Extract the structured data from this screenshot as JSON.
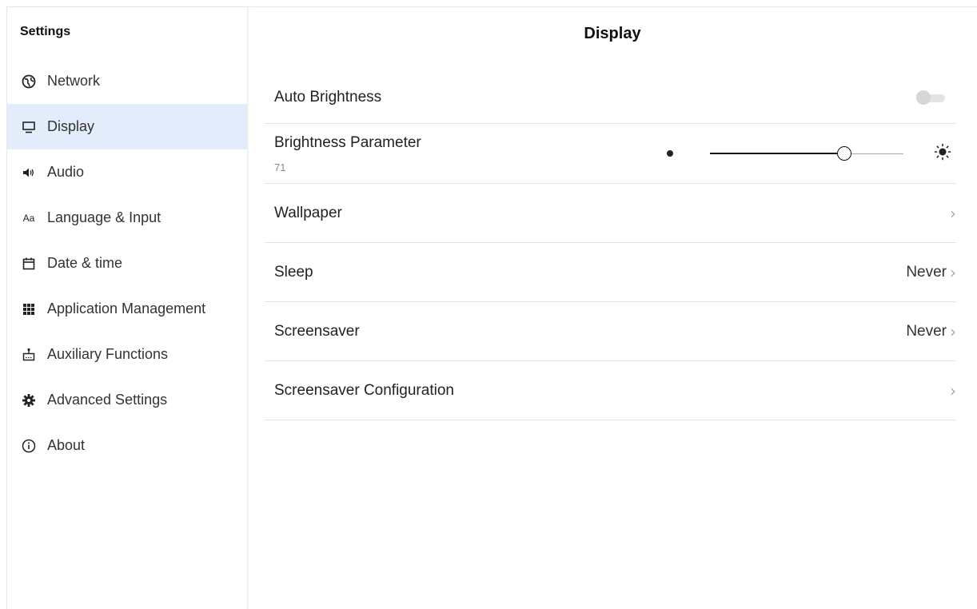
{
  "sidebar": {
    "title": "Settings",
    "items": [
      {
        "label": "Network",
        "icon": "globe-icon"
      },
      {
        "label": "Display",
        "icon": "monitor-icon"
      },
      {
        "label": "Audio",
        "icon": "speaker-icon"
      },
      {
        "label": "Language & Input",
        "icon": "text-aa-icon",
        "glyph": "Aa"
      },
      {
        "label": "Date & time",
        "icon": "calendar-icon"
      },
      {
        "label": "Application Management",
        "icon": "grid-icon"
      },
      {
        "label": "Auxiliary Functions",
        "icon": "accessibility-icon"
      },
      {
        "label": "Advanced Settings",
        "icon": "gear-icon"
      },
      {
        "label": "About",
        "icon": "info-icon"
      }
    ],
    "active_index": 1
  },
  "main": {
    "title": "Display",
    "auto_brightness": {
      "label": "Auto Brightness",
      "enabled": false
    },
    "brightness": {
      "label": "Brightness Parameter",
      "value": "71",
      "fraction": 0.71
    },
    "wallpaper": {
      "label": "Wallpaper",
      "chevron": "›"
    },
    "sleep": {
      "label": "Sleep",
      "value": "Never",
      "chevron": "›"
    },
    "screensaver": {
      "label": "Screensaver",
      "value": "Never",
      "chevron": "›"
    },
    "screensaver_config": {
      "label": "Screensaver Configuration",
      "chevron": "›"
    }
  },
  "colors": {
    "active_bg": "#e3ecfb",
    "divider": "#e3e3e3",
    "toggle_off": "#d6d6d6"
  }
}
